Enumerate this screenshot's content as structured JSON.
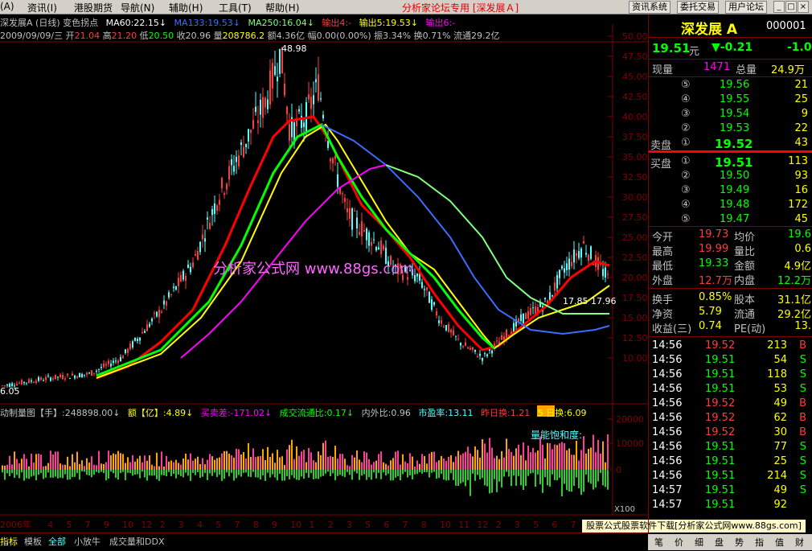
{
  "menu": {
    "items": [
      "(A)",
      "资讯(I)",
      "港股期货",
      "导航(N)",
      "辅助(H)",
      "工具(T)",
      "帮助(H)"
    ],
    "title": "分析家论坛专用 [深发展Ａ]",
    "buttons": [
      "资讯系统",
      "委托交易",
      "用户论坛"
    ]
  },
  "stock_info": {
    "name_line": "深发展A (日线) 变色拐点",
    "ma60": "MA60:22.15↓",
    "ma133": "MA133:19.53↓",
    "ma250": "MA250:16.04↓",
    "out4": "输出4:-",
    "out5": "输出5:19.53↓",
    "out6": "输出6:-",
    "date": "2009/09/09/三",
    "open_label": "开",
    "open": "21.04",
    "high_label": "高",
    "high": "21.20",
    "low_label": "低",
    "low": "20.50",
    "close_label": "收",
    "close": "20.96",
    "vol_label": "量",
    "vol": "208786.2",
    "amount_label": "额",
    "amount": "4.36亿",
    "change_label": "幅",
    "change": "0.00(0.00%)",
    "amp_label": "振",
    "amp": "3.34%",
    "turn_label": "换",
    "turn": "0.71%",
    "float_label": "流通",
    "float": "29.2亿"
  },
  "price_chart": {
    "y_ticks": [
      "50.00",
      "47.50",
      "45.00",
      "42.50",
      "40.00",
      "37.50",
      "35.00",
      "32.50",
      "30.00",
      "27.50",
      "25.00",
      "22.50",
      "20.00",
      "17.50",
      "15.00",
      "12.50",
      "10.00"
    ],
    "peak_label": "48.98",
    "low_label": "6.05",
    "right_labels": "17.85 17.96",
    "watermark": "分析家公式网  www.88gs.com"
  },
  "volume_info": {
    "label1": "动制量图【手】:248898.00↓",
    "label2": "额【亿】:4.89↓",
    "label3": "买卖差:-171.02↓",
    "label4": "成交流通比:0.17↓",
    "label5": "内外比:0.96",
    "label6": "市盈率:13.11",
    "label7": "昨日换:1.21",
    "label8": "5 日换:6.09",
    "overlay": "量能饱和度:",
    "y_ticks": [
      "20000",
      "10000",
      "0"
    ],
    "scale": "X100"
  },
  "x_axis": {
    "labels": [
      "2006年",
      "4",
      "5",
      "7",
      "9",
      "10",
      "12",
      "2",
      "3",
      "4",
      "5",
      "7",
      "8",
      "9",
      "10",
      "1",
      "2",
      "3",
      "5",
      "6",
      "7",
      "8",
      "10",
      "11",
      "12",
      "2",
      "3",
      "5",
      "6",
      "7",
      "8"
    ]
  },
  "bottom_tabs": [
    "指标",
    "模板",
    "全部",
    "小放牛",
    "成交量和DDX"
  ],
  "footer_link": "股票公式股票软件下载[分析家公式网www.88gs.com]",
  "quote": {
    "name": "深发展 A",
    "code": "000001",
    "price": "19.51",
    "price_unit": "元",
    "change": "▼-0.21",
    "change_pct": "-1.0",
    "current_vol_label": "现量",
    "current_vol": "1471",
    "total_vol_label": "总量",
    "total_vol": "24.9万",
    "asks": [
      {
        "level": "⑤",
        "price": "19.56",
        "vol": "21"
      },
      {
        "level": "④",
        "price": "19.55",
        "vol": "25"
      },
      {
        "level": "③",
        "price": "19.54",
        "vol": "9"
      },
      {
        "level": "②",
        "price": "19.53",
        "vol": "22"
      },
      {
        "level": "①",
        "price": "19.52",
        "vol": "43"
      }
    ],
    "ask_label": "卖盘",
    "bid_label": "买盘",
    "bids": [
      {
        "level": "①",
        "price": "19.51",
        "vol": "113"
      },
      {
        "level": "②",
        "price": "19.50",
        "vol": "93"
      },
      {
        "level": "③",
        "price": "19.49",
        "vol": "16"
      },
      {
        "level": "④",
        "price": "19.48",
        "vol": "172"
      },
      {
        "level": "⑤",
        "price": "19.47",
        "vol": "45"
      }
    ],
    "stats": [
      {
        "l1": "今开",
        "v1": "19.73",
        "l2": "均价",
        "v2": "19.6"
      },
      {
        "l1": "最高",
        "v1": "19.99",
        "l2": "量比",
        "v2": "0.6"
      },
      {
        "l1": "最低",
        "v1": "19.33",
        "l2": "金额",
        "v2": "4.9亿"
      },
      {
        "l1": "外盘",
        "v1": "12.7万",
        "l2": "内盘",
        "v2": "12.2万"
      }
    ],
    "stats2": [
      {
        "l1": "换手",
        "v1": "0.85%",
        "l2": "股本",
        "v2": "31.1亿"
      },
      {
        "l1": "净资",
        "v1": "5.79",
        "l2": "流通",
        "v2": "29.2亿"
      },
      {
        "l1": "收益(三)",
        "v1": "0.74",
        "l2": "PE(动)",
        "v2": "13."
      }
    ],
    "ticks": [
      {
        "time": "14:56",
        "price": "19.52",
        "vol": "213",
        "side": "B"
      },
      {
        "time": "14:56",
        "price": "19.51",
        "vol": "54",
        "side": "S"
      },
      {
        "time": "14:56",
        "price": "19.51",
        "vol": "118",
        "side": "S"
      },
      {
        "time": "14:56",
        "price": "19.51",
        "vol": "53",
        "side": "S"
      },
      {
        "time": "14:56",
        "price": "19.52",
        "vol": "49",
        "side": "B"
      },
      {
        "time": "14:56",
        "price": "19.52",
        "vol": "62",
        "side": "B"
      },
      {
        "time": "14:56",
        "price": "19.52",
        "vol": "30",
        "side": "B"
      },
      {
        "time": "14:56",
        "price": "19.51",
        "vol": "77",
        "side": "S"
      },
      {
        "time": "14:56",
        "price": "19.51",
        "vol": "25",
        "side": "S"
      },
      {
        "time": "14:56",
        "price": "19.51",
        "vol": "214",
        "side": "S"
      },
      {
        "time": "14:57",
        "price": "19.51",
        "vol": "49",
        "side": "S"
      },
      {
        "time": "14:57",
        "price": "19.51",
        "vol": "92",
        "side": ""
      }
    ],
    "bottom_tabs": [
      "笔",
      "价",
      "细",
      "盘",
      "势",
      "指",
      "值",
      "财"
    ]
  },
  "colors": {
    "up": "#ff3c3c",
    "down": "#54ffff",
    "ma_red": "#ff0000",
    "ma_yellow": "#ffff00",
    "ma_green": "#00ff00",
    "ma_blue": "#3c6cff",
    "ma_magenta": "#ff00ff",
    "ma_lightgreen": "#80ff80"
  }
}
